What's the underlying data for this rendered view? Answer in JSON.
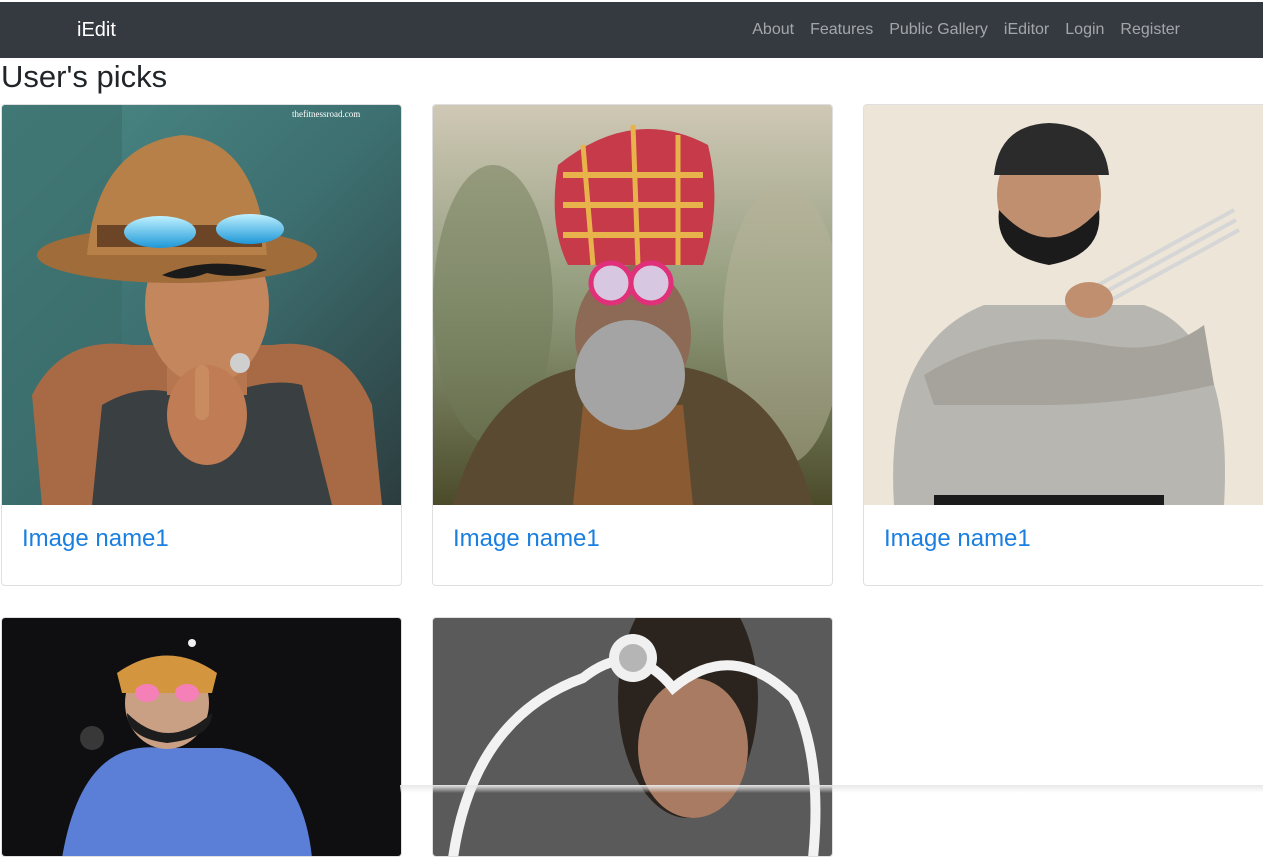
{
  "navbar": {
    "brand": "iEdit",
    "links": [
      "About",
      "Features",
      "Public Gallery",
      "iEditor",
      "Login",
      "Register"
    ]
  },
  "page": {
    "title": "User's picks"
  },
  "cards": [
    {
      "title": "Image name1",
      "image": "man-hat-sunglasses-mustache"
    },
    {
      "title": "Image name1",
      "image": "man-turban-pink-glasses-beard"
    },
    {
      "title": "Image name1",
      "image": "man-beanie-claws"
    },
    {
      "title": "",
      "image": "man-hat-heart-glasses"
    },
    {
      "title": "",
      "image": "man-ornate-frame"
    }
  ],
  "watermark": "thefitnessroad.com"
}
